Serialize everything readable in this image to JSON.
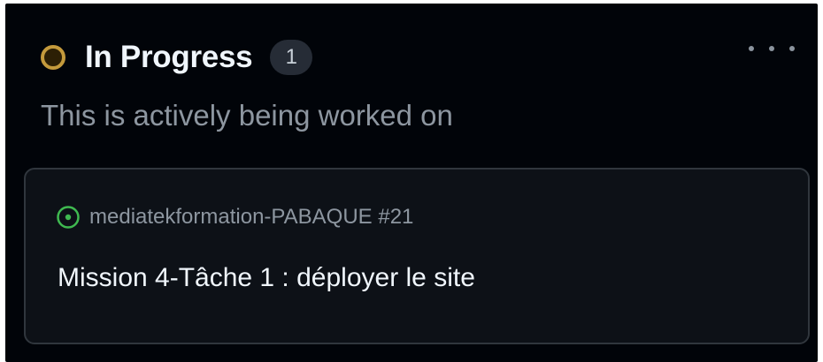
{
  "column": {
    "title": "In Progress",
    "count": "1",
    "description": "This is actively being worked on",
    "status_color": "#c49a3c",
    "more_icon": "ellipsis-horizontal"
  },
  "card": {
    "state_icon": "issue-opened-icon",
    "state_color": "#3fb950",
    "repo_ref": "mediatekformation-PABAQUE #21",
    "title": "Mission 4-Tâche 1 : déployer le site"
  }
}
